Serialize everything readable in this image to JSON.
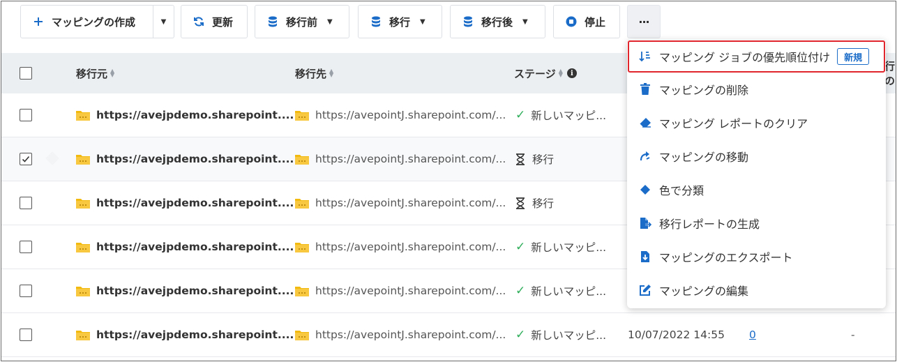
{
  "toolbar": {
    "create_mapping": "マッピングの作成",
    "refresh": "更新",
    "pre_migration": "移行前",
    "migration": "移行",
    "post_migration": "移行後",
    "stop": "停止",
    "more": "···"
  },
  "table": {
    "headers": {
      "source": "移行元",
      "destination": "移行先",
      "stage": "ステージ",
      "clipped": "行の"
    },
    "rows": [
      {
        "checked": false,
        "source": "https://avejpdemo.sharepoint....",
        "destination": "https://avepointJ.sharepoint.com/...",
        "stage_type": "check",
        "stage": "新しいマッピ..."
      },
      {
        "checked": true,
        "source": "https://avejpdemo.sharepoint....",
        "destination": "https://avepointJ.sharepoint.com/...",
        "stage_type": "hourglass",
        "stage": "移行"
      },
      {
        "checked": false,
        "source": "https://avejpdemo.sharepoint....",
        "destination": "https://avepointJ.sharepoint.com/...",
        "stage_type": "hourglass",
        "stage": "移行"
      },
      {
        "checked": false,
        "source": "https://avejpdemo.sharepoint....",
        "destination": "https://avepointJ.sharepoint.com/...",
        "stage_type": "check",
        "stage": "新しいマッピ..."
      },
      {
        "checked": false,
        "source": "https://avejpdemo.sharepoint....",
        "destination": "https://avepointJ.sharepoint.com/...",
        "stage_type": "check",
        "stage": "新しいマッピ..."
      },
      {
        "checked": false,
        "source": "https://avejpdemo.sharepoint....",
        "destination": "https://avepointJ.sharepoint.com/...",
        "stage_type": "check",
        "stage": "新しいマッピ...",
        "date": "10/07/2022 14:55",
        "count": "0",
        "extra": "-"
      }
    ]
  },
  "menu": {
    "items": [
      {
        "label": "マッピング ジョブの優先順位付け",
        "icon": "sort-priority-icon",
        "badge": "新規"
      },
      {
        "label": "マッピングの削除",
        "icon": "trash-icon"
      },
      {
        "label": "マッピング レポートのクリア",
        "icon": "eraser-icon"
      },
      {
        "label": "マッピングの移動",
        "icon": "move-arrow-icon"
      },
      {
        "label": "色で分類",
        "icon": "diamond-icon"
      },
      {
        "label": "移行レポートの生成",
        "icon": "file-export-icon"
      },
      {
        "label": "マッピングのエクスポート",
        "icon": "file-download-icon"
      },
      {
        "label": "マッピングの編集",
        "icon": "edit-icon"
      }
    ]
  },
  "colors": {
    "accent": "#1a6cc8",
    "success": "#2fae5a",
    "highlight": "#e0252d",
    "folder": "#f2b90f"
  }
}
